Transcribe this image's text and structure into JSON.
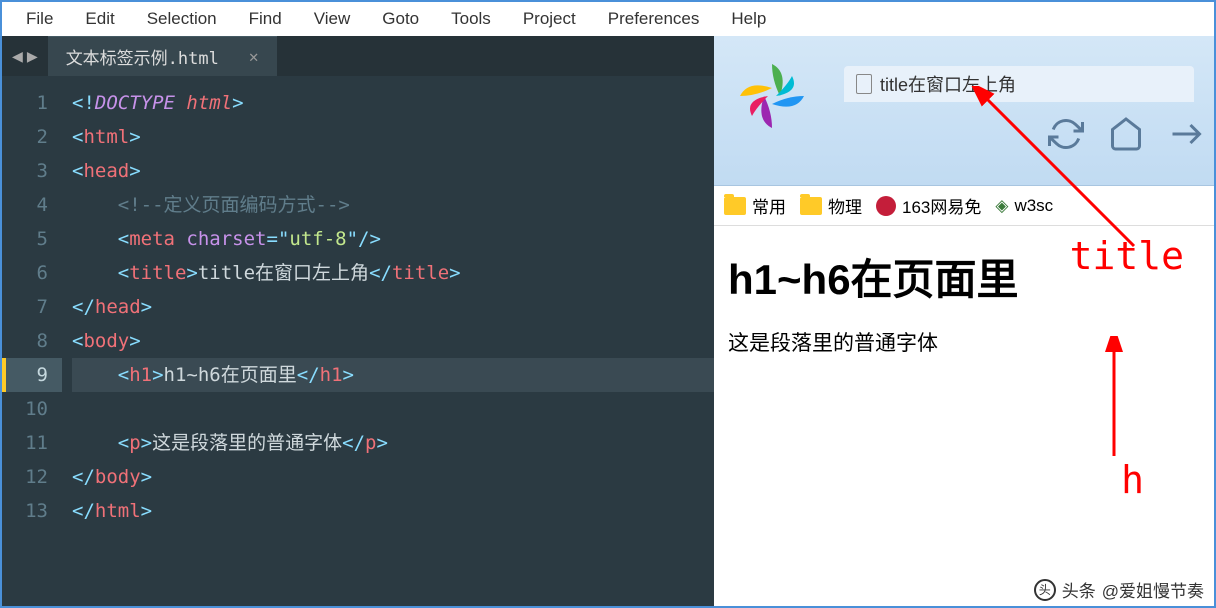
{
  "menu": [
    "File",
    "Edit",
    "Selection",
    "Find",
    "View",
    "Goto",
    "Tools",
    "Project",
    "Preferences",
    "Help"
  ],
  "tab": {
    "name": "文本标签示例.html"
  },
  "gutter": [
    "1",
    "2",
    "3",
    "4",
    "5",
    "6",
    "7",
    "8",
    "9",
    "10",
    "11",
    "12",
    "13"
  ],
  "code": {
    "l1_a": "<!",
    "l1_b": "DOCTYPE ",
    "l1_c": "html",
    "l1_d": ">",
    "l2_a": "<",
    "l2_b": "html",
    "l2_c": ">",
    "l3_a": "<",
    "l3_b": "head",
    "l3_c": ">",
    "l4": "    <!--定义页面编码方式-->",
    "l5_a": "    <",
    "l5_b": "meta ",
    "l5_attr": "charset",
    "l5_eq": "=",
    "l5_q1": "\"",
    "l5_val": "utf-8",
    "l5_q2": "\"",
    "l5_c": "/>",
    "l6_a": "    <",
    "l6_b": "title",
    "l6_c": ">",
    "l6_txt": "title在窗口左上角",
    "l6_d": "</",
    "l6_e": "title",
    "l6_f": ">",
    "l7_a": "</",
    "l7_b": "head",
    "l7_c": ">",
    "l8_a": "<",
    "l8_b": "body",
    "l8_c": ">",
    "l9_a": "    <",
    "l9_b": "h1",
    "l9_c": ">",
    "l9_txt": "h1~h6在页面里",
    "l9_d": "</",
    "l9_e": "h1",
    "l9_f": ">",
    "l11_a": "    <",
    "l11_b": "p",
    "l11_c": ">",
    "l11_txt": "这是段落里的普通字体",
    "l11_d": "</",
    "l11_e": "p",
    "l11_f": ">",
    "l12_a": "</",
    "l12_b": "body",
    "l12_c": ">",
    "l13_a": "</",
    "l13_b": "html",
    "l13_c": ">"
  },
  "browser": {
    "tab_title": "title在窗口左上角",
    "bookmarks": {
      "b1": "常用",
      "b2": "物理",
      "b3": "163网易免",
      "b4": "w3sc"
    },
    "h1": "h1~h6在页面里",
    "p": "这是段落里的普通字体"
  },
  "annot": {
    "title": "title",
    "h": "h"
  },
  "footer": {
    "label": "头条",
    "author": "@爱姐慢节奏"
  }
}
